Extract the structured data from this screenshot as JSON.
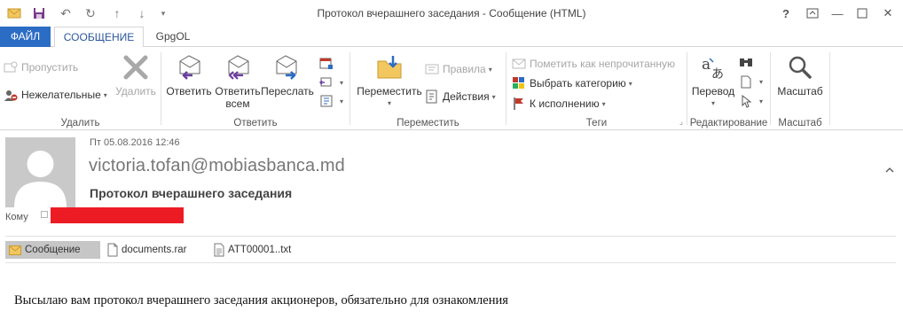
{
  "window": {
    "title": "Протокол вчерашнего заседания - Сообщение (HTML)",
    "controls": {
      "help": "?",
      "minimize": "—",
      "close": "✕"
    }
  },
  "tabs": [
    {
      "label": "ФАЙЛ"
    },
    {
      "label": "СООБЩЕНИЕ"
    },
    {
      "label": "GpgOL"
    }
  ],
  "ribbon": {
    "delete_group": {
      "label": "Удалить",
      "ignore": "Пропустить",
      "junk": "Нежелательные",
      "delete": "Удалить"
    },
    "respond_group": {
      "label": "Ответить",
      "reply": "Ответить",
      "reply_all_line1": "Ответить",
      "reply_all_line2": "всем",
      "forward": "Переслать"
    },
    "move_group": {
      "label": "Переместить",
      "move": "Переместить",
      "rules": "Правила",
      "actions": "Действия"
    },
    "tags_group": {
      "label": "Теги",
      "mark_unread": "Пометить как непрочитанную",
      "categorize": "Выбрать категорию",
      "follow_up": "К исполнению"
    },
    "editing_group": {
      "label": "Редактирование",
      "translate": "Перевод"
    },
    "zoom_group": {
      "label": "Масштаб",
      "zoom": "Масштаб"
    }
  },
  "message": {
    "date": "Пт 05.08.2016 12:46",
    "sender": "victoria.tofan@mobiasbanca.md",
    "subject": "Протокол вчерашнего заседания",
    "to_label": "Кому"
  },
  "attachments": [
    {
      "name": "Сообщение",
      "icon": "envelope-icon"
    },
    {
      "name": "documents.rar",
      "icon": "file-icon"
    },
    {
      "name": "ATT00001..txt",
      "icon": "text-file-icon"
    }
  ],
  "body": {
    "text": "Высылаю вам протокол вчерашнего заседания акционеров, обязательно для ознакомления"
  },
  "colors": {
    "accent": "#2b579a",
    "file_tab": "#2b6cc4",
    "redaction": "#ed1c24"
  }
}
